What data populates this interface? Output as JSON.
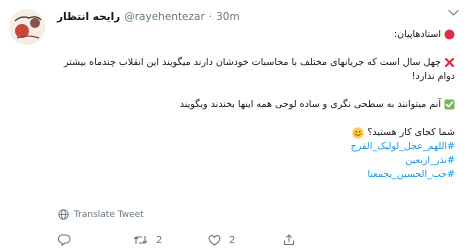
{
  "tweet": {
    "author_name": "رایحه انتظار",
    "handle": "@rayehentezar",
    "separator": "·",
    "time": "30m",
    "lines": [
      "استادهاپیان:",
      "چهل سال است که جریانهای مختلف با محاسبات خودشان دارند میگویند این انقلاب چندماه بیشتر دوام ندارد!",
      "آنم میتوانند به سطحی نگری و ساده لوحی همه اینها بخندند وبگویند",
      "شما کجای کار هستید؟"
    ],
    "hashtags": [
      "#اللهم_عجل_لولیک_الفرج",
      "#نذر_اربعین",
      "#حب_الحسین_یجمعنا"
    ],
    "translate_label": "Translate Tweet",
    "actions": {
      "reply_count": "",
      "retweet_count": "2",
      "like_count": "2"
    }
  }
}
